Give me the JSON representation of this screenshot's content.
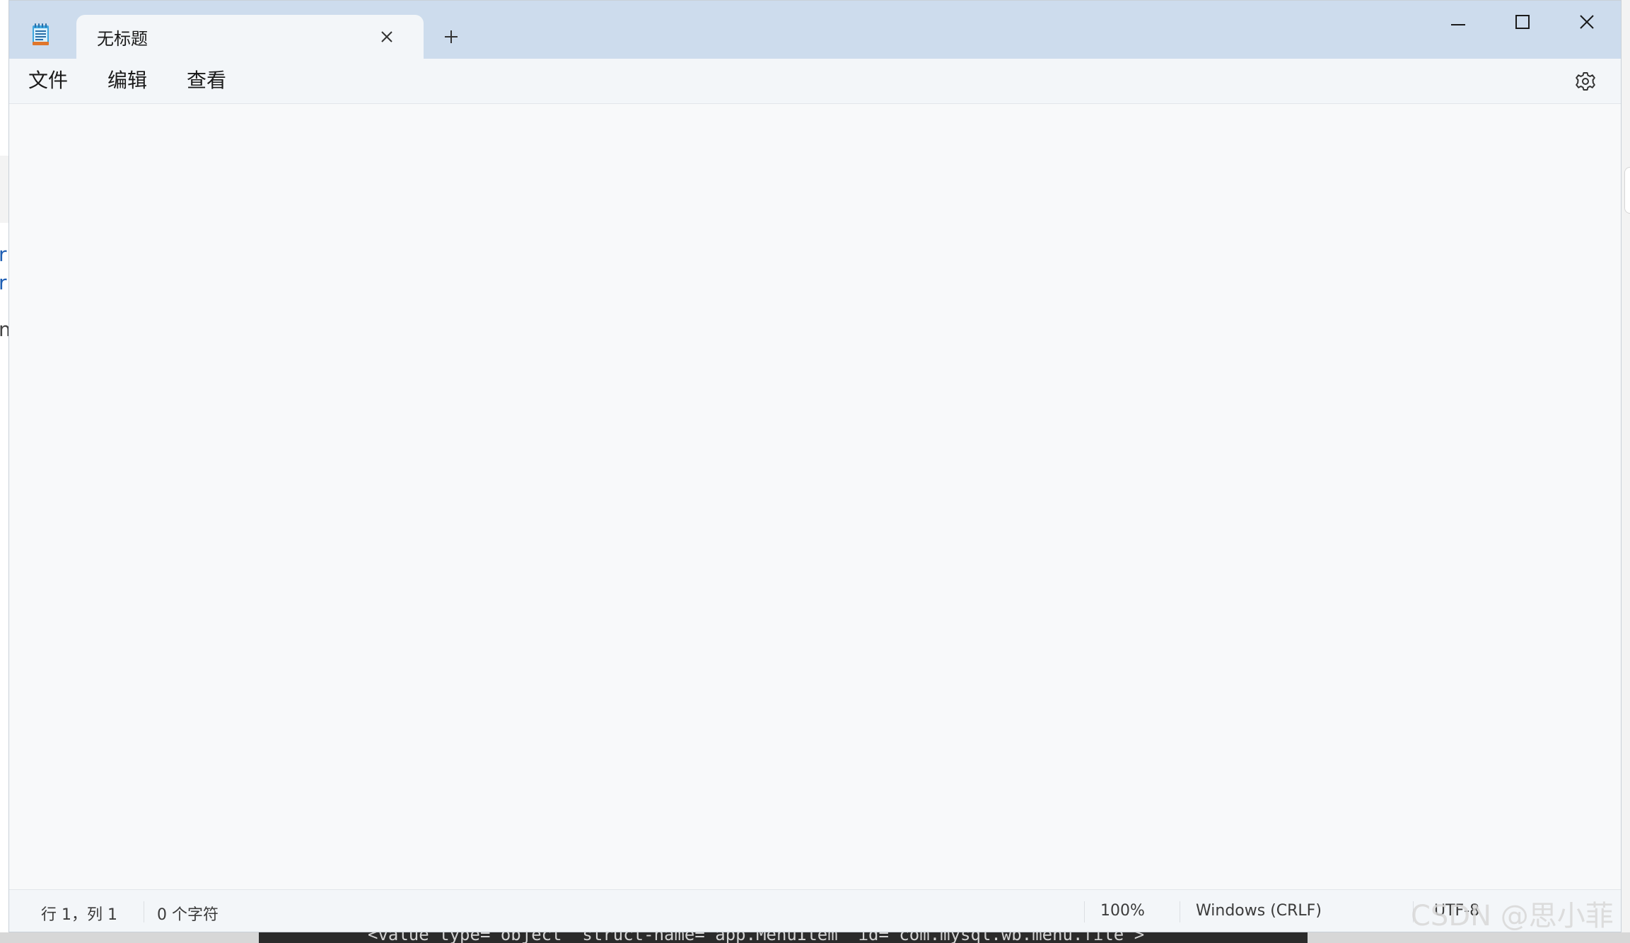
{
  "window": {
    "tab_title": "无标题",
    "icons": {
      "app": "notepad-icon",
      "tab_close": "close-icon",
      "new_tab": "plus-icon",
      "minimize": "minimize-icon",
      "maximize": "maximize-icon",
      "close": "close-icon",
      "settings": "gear-icon"
    }
  },
  "menu": {
    "file": "文件",
    "edit": "编辑",
    "view": "查看"
  },
  "editor": {
    "content": ""
  },
  "status": {
    "position": "行 1，列 1",
    "chars": "0 个字符",
    "zoom": "100%",
    "line_ending": "Windows (CRLF)",
    "encoding": "UTF-8"
  },
  "background": {
    "left_chars": [
      "r",
      "r",
      "m"
    ],
    "top_dots": "· · · · · ·",
    "code_line": "<value type=\"object\" struct-name=\"app.MenuItem\" id=\"com.mysql.wb.menu.file\">"
  },
  "watermark": "CSDN @思小菲",
  "colors": {
    "titlebar": "#cddced",
    "tab": "#f3f6f9",
    "editor_bg": "#f8f9fa",
    "text": "#1a1a1a",
    "status_text": "#3b3b3b"
  }
}
